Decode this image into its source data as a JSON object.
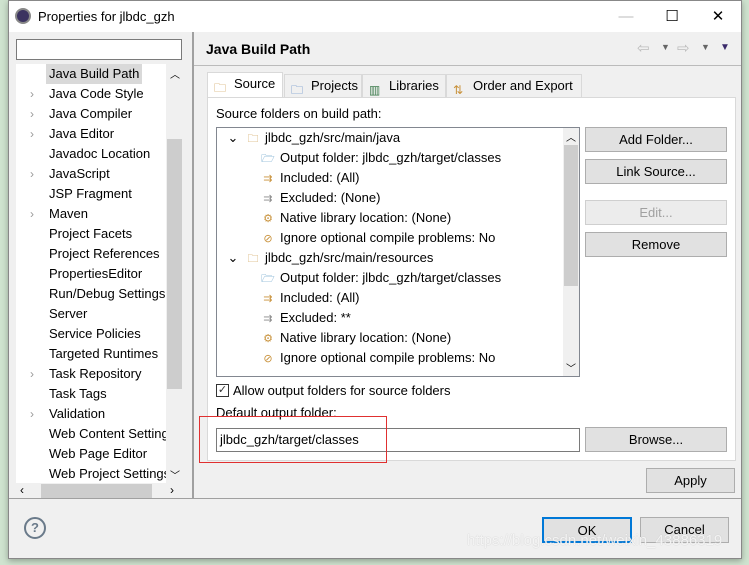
{
  "window": {
    "title": "Properties for jlbdc_gzh",
    "minimize": "—",
    "maximize": "☐",
    "close": "✕"
  },
  "filter": {
    "value": "",
    "placeholder": ""
  },
  "sidebar": {
    "items": [
      {
        "label": "Java Build Path",
        "expandable": false,
        "selected": true
      },
      {
        "label": "Java Code Style",
        "expandable": true
      },
      {
        "label": "Java Compiler",
        "expandable": true
      },
      {
        "label": "Java Editor",
        "expandable": true
      },
      {
        "label": "Javadoc Location",
        "expandable": false
      },
      {
        "label": "JavaScript",
        "expandable": true
      },
      {
        "label": "JSP Fragment",
        "expandable": false
      },
      {
        "label": "Maven",
        "expandable": true
      },
      {
        "label": "Project Facets",
        "expandable": false
      },
      {
        "label": "Project References",
        "expandable": false
      },
      {
        "label": "PropertiesEditor",
        "expandable": false
      },
      {
        "label": "Run/Debug Settings",
        "expandable": false
      },
      {
        "label": "Server",
        "expandable": false
      },
      {
        "label": "Service Policies",
        "expandable": false
      },
      {
        "label": "Targeted Runtimes",
        "expandable": false
      },
      {
        "label": "Task Repository",
        "expandable": true
      },
      {
        "label": "Task Tags",
        "expandable": false
      },
      {
        "label": "Validation",
        "expandable": true
      },
      {
        "label": "Web Content Settings",
        "expandable": false
      },
      {
        "label": "Web Page Editor",
        "expandable": false
      },
      {
        "label": "Web Project Settings",
        "expandable": false
      }
    ]
  },
  "page": {
    "title": "Java Build Path"
  },
  "tabs": [
    {
      "label": "Source",
      "active": true
    },
    {
      "label": "Projects"
    },
    {
      "label": "Libraries"
    },
    {
      "label": "Order and Export"
    }
  ],
  "source": {
    "heading": "Source folders on build path:",
    "tree": [
      {
        "level": 0,
        "text": "jlbdc_gzh/src/main/java",
        "icon": "source-folder-icon"
      },
      {
        "level": 1,
        "text": "Output folder: jlbdc_gzh/target/classes",
        "icon": "output-folder-icon"
      },
      {
        "level": 1,
        "text": "Included: (All)",
        "icon": "included-icon"
      },
      {
        "level": 1,
        "text": "Excluded: (None)",
        "icon": "excluded-icon"
      },
      {
        "level": 1,
        "text": "Native library location: (None)",
        "icon": "native-library-icon"
      },
      {
        "level": 1,
        "text": "Ignore optional compile problems: No",
        "icon": "ignore-problems-icon"
      },
      {
        "level": 0,
        "text": "jlbdc_gzh/src/main/resources",
        "icon": "source-folder-icon"
      },
      {
        "level": 1,
        "text": "Output folder: jlbdc_gzh/target/classes",
        "icon": "output-folder-icon"
      },
      {
        "level": 1,
        "text": "Included: (All)",
        "icon": "included-icon"
      },
      {
        "level": 1,
        "text": "Excluded: **",
        "icon": "excluded-icon"
      },
      {
        "level": 1,
        "text": "Native library location: (None)",
        "icon": "native-library-icon"
      },
      {
        "level": 1,
        "text": "Ignore optional compile problems: No",
        "icon": "ignore-problems-icon"
      }
    ],
    "buttons": {
      "add_folder": "Add Folder...",
      "link_source": "Link Source...",
      "edit": "Edit...",
      "remove": "Remove",
      "browse": "Browse..."
    },
    "allow_output_label": "Allow output folders for source folders",
    "allow_output_checked": true,
    "default_output_label": "Default output folder:",
    "default_output_value": "jlbdc_gzh/target/classes"
  },
  "footer": {
    "apply": "Apply",
    "ok": "OK",
    "cancel": "Cancel"
  },
  "watermark": "https://blog.csdn.net/weixin_43886319",
  "colors": {
    "highlight_box": "#e03030",
    "ok_border": "#0078d7"
  }
}
